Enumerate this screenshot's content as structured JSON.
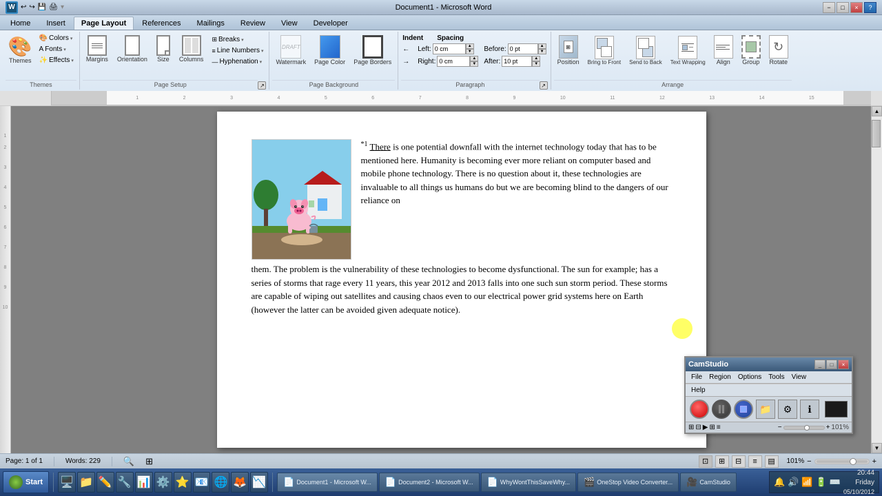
{
  "window": {
    "title": "Document1 - Microsoft Word",
    "minimize_label": "−",
    "restore_label": "□",
    "close_label": "×"
  },
  "ribbon": {
    "tabs": [
      "Home",
      "Insert",
      "Page Layout",
      "References",
      "Mailings",
      "Review",
      "View",
      "Developer"
    ],
    "active_tab": "Page Layout",
    "themes_group": {
      "label": "Themes",
      "themes_btn": "Themes",
      "colors_btn": "Colors",
      "fonts_btn": "Fonts",
      "effects_btn": "Effects"
    },
    "page_setup_group": {
      "label": "Page Setup",
      "margins_btn": "Margins",
      "orientation_btn": "Orientation",
      "size_btn": "Size",
      "columns_btn": "Columns",
      "breaks_btn": "Breaks",
      "line_numbers_btn": "Line Numbers",
      "hyphenation_btn": "Hyphenation"
    },
    "page_background_group": {
      "label": "Page Background",
      "watermark_btn": "Watermark",
      "page_color_btn": "Page Color",
      "page_borders_btn": "Page Borders"
    },
    "paragraph_group": {
      "label": "Paragraph",
      "indent_label": "Indent",
      "spacing_label": "Spacing",
      "left_label": "Left:",
      "right_label": "Right:",
      "before_label": "Before:",
      "after_label": "After:",
      "left_value": "0 cm",
      "right_value": "0 cm",
      "before_value": "0 pt",
      "after_value": "10 pt"
    },
    "arrange_group": {
      "label": "Arrange",
      "position_btn": "Position",
      "bring_to_front_btn": "Bring to Front",
      "send_to_back_btn": "Send to Back",
      "text_wrapping_btn": "Text Wrapping",
      "align_btn": "Align",
      "group_btn": "Group",
      "rotate_btn": "Rotate"
    }
  },
  "document": {
    "text": "*1 There is one potential downfall with the internet technology today that has to be mentioned here. Humanity is becoming ever more reliant on computer based and mobile phone technology. There is no question about it, these technologies are invaluable to all things us humans do but we are becoming blind to the dangers of our reliance on them. The problem is the vulnerability of these technologies to become dysfunctional. The sun for example; has a series of storms that rage every 11 years, this year 2012 and 2013 falls into one such sun storm period. These storms are capable of wiping out satellites and causing chaos even to our electrical power grid systems here on Earth (however the latter can be avoided given adequate notice)."
  },
  "status_bar": {
    "page_info": "Page: 1 of 1",
    "words": "Words: 229",
    "zoom": "101%"
  },
  "taskbar": {
    "start_label": "Start",
    "time": "20:44",
    "date": "Friday",
    "date2": "05/10/2012",
    "windows": [
      {
        "label": "Document1 - Microsoft W...",
        "active": true,
        "icon": "📄"
      },
      {
        "label": "Document2 - Microsoft W...",
        "active": false,
        "icon": "📄"
      },
      {
        "label": "WhyWontThisSaveWhy...",
        "active": false,
        "icon": "📄"
      },
      {
        "label": "OneStop Video Converter...",
        "active": false,
        "icon": "🎬"
      },
      {
        "label": "CamStudio",
        "active": false,
        "icon": "🎥"
      }
    ],
    "taskbar_icons": [
      "🖥️",
      "🌳",
      "✏️",
      "🔴",
      "🎭",
      "🔵",
      "⚙️",
      "📧",
      "🌐",
      "🔥",
      "📊"
    ]
  },
  "camstudio": {
    "title": "CamStudio",
    "menu": [
      "File",
      "Region",
      "Options",
      "Tools",
      "View",
      "Help"
    ],
    "buttons": [
      "record",
      "pause",
      "stop",
      "open",
      "settings",
      "info"
    ],
    "display": ""
  }
}
